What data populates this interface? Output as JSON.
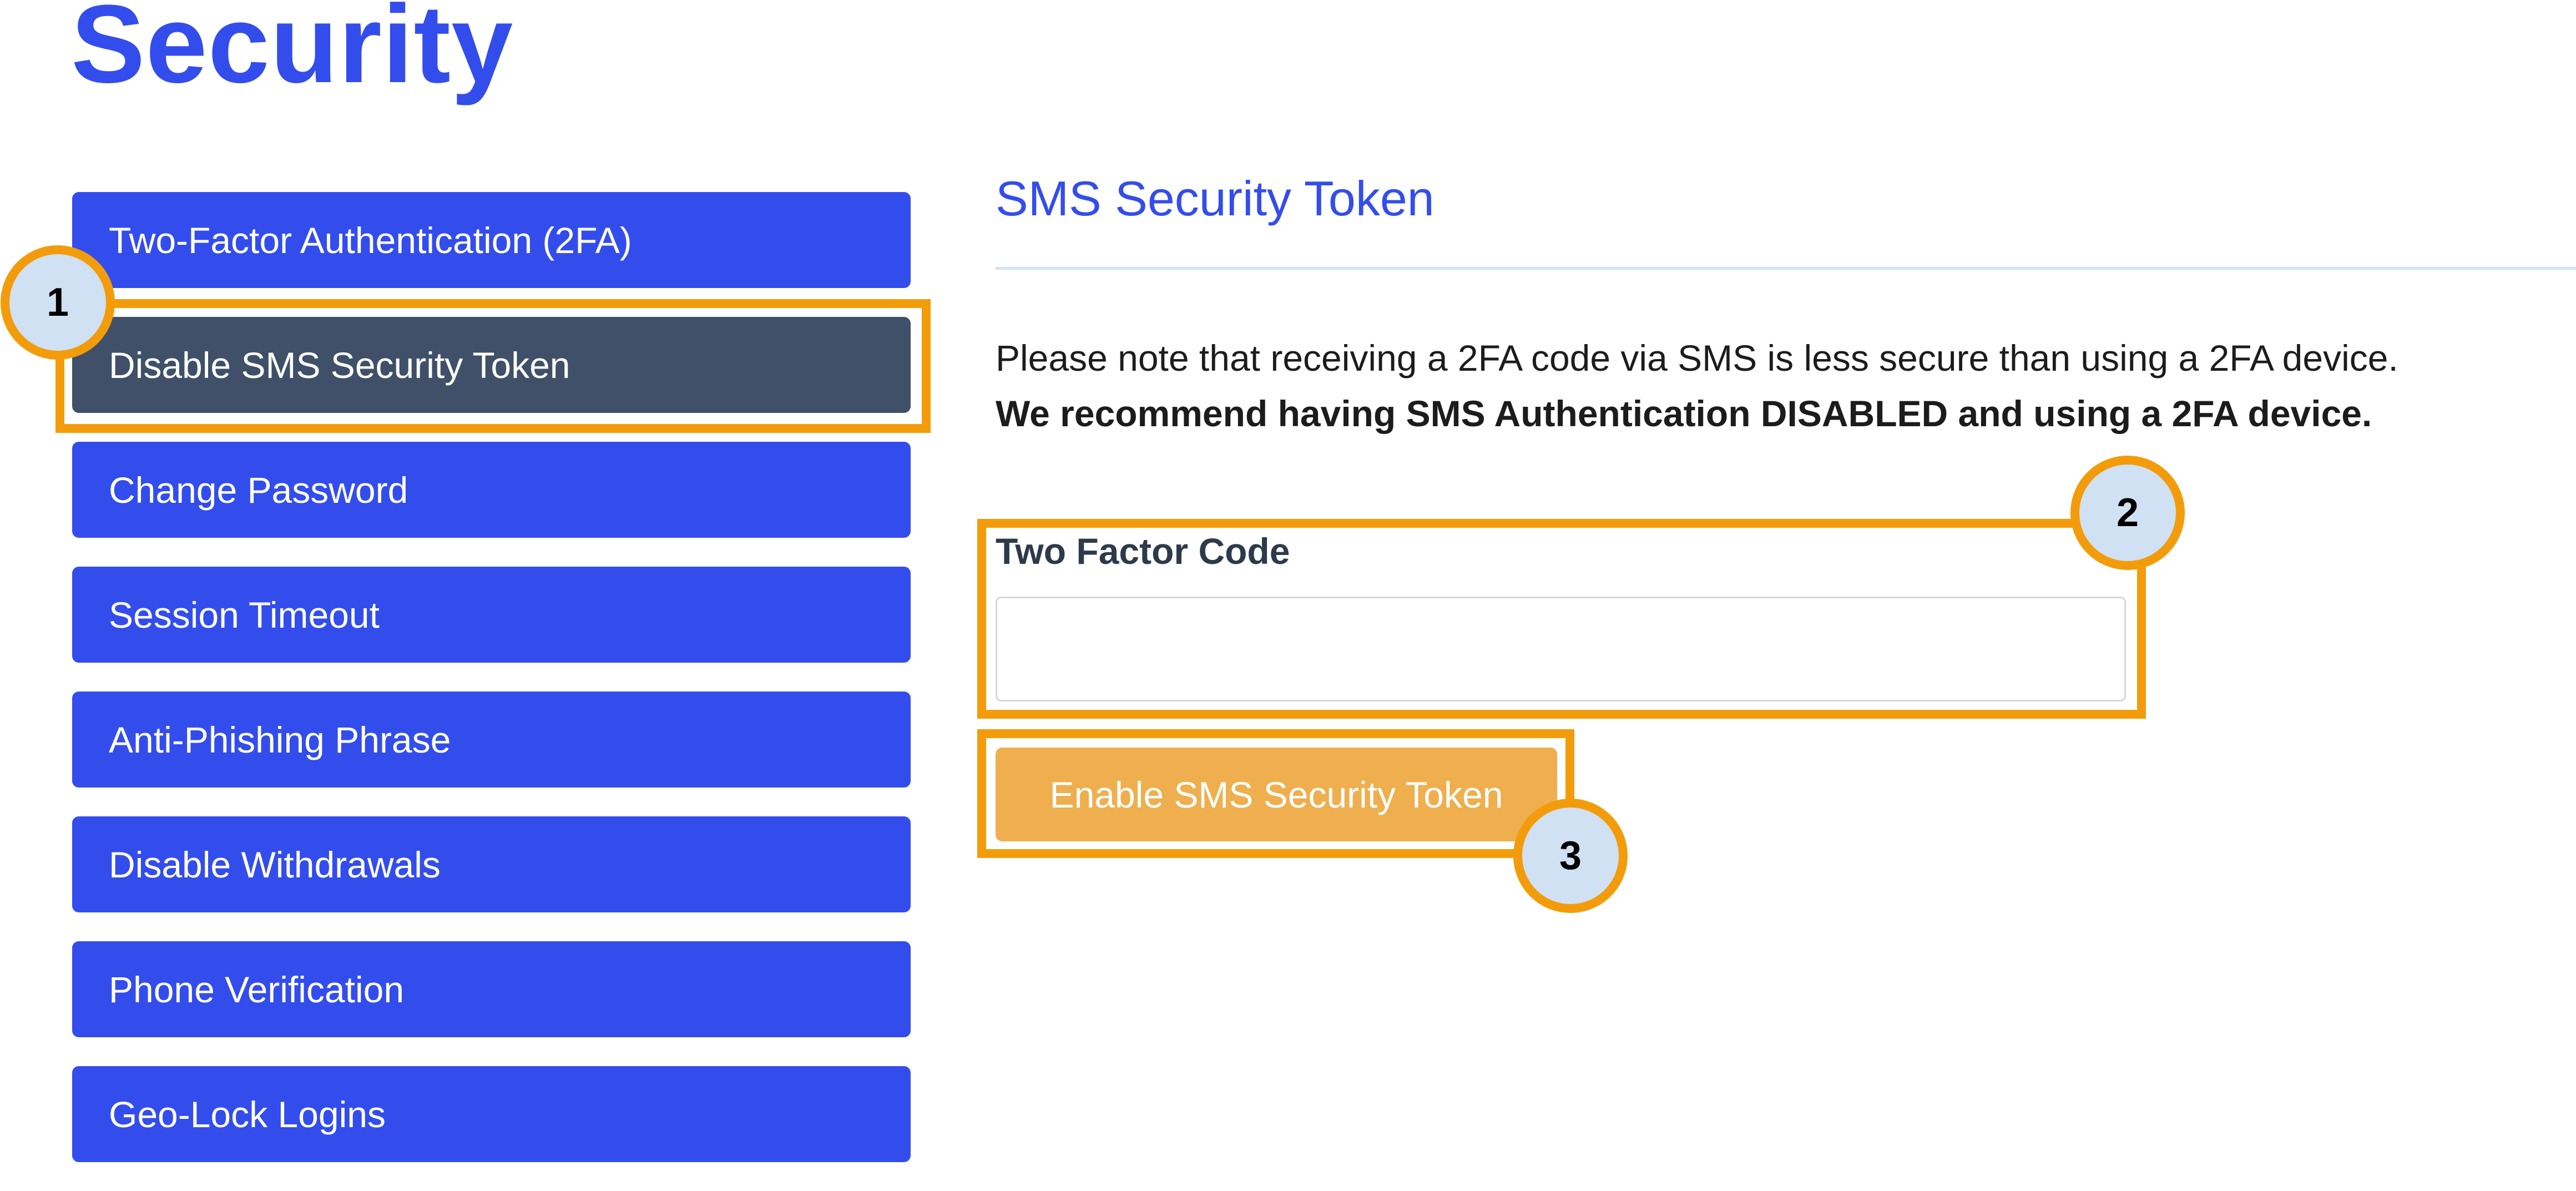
{
  "page": {
    "title": "Security"
  },
  "sidebar": {
    "active_index": 1,
    "items": [
      {
        "label": "Two-Factor Authentication (2FA)"
      },
      {
        "label": "Disable SMS Security Token"
      },
      {
        "label": "Change Password"
      },
      {
        "label": "Session Timeout"
      },
      {
        "label": "Anti-Phishing Phrase"
      },
      {
        "label": "Disable Withdrawals"
      },
      {
        "label": "Phone Verification"
      },
      {
        "label": "Geo-Lock Logins"
      }
    ]
  },
  "main": {
    "heading": "SMS Security Token",
    "note_line1": "Please note that receiving a 2FA code via SMS is less secure than using a 2FA device.",
    "note_line2": "We recommend having SMS Authentication DISABLED and using a 2FA device.",
    "field_label": "Two Factor Code",
    "field_value": "",
    "field_placeholder": "",
    "submit_label": "Enable SMS Security Token"
  },
  "annotations": [
    {
      "number": "1",
      "target": "Disable SMS Security Token menu item"
    },
    {
      "number": "2",
      "target": "Two Factor Code field"
    },
    {
      "number": "3",
      "target": "Enable SMS Security Token button"
    }
  ],
  "colors": {
    "brand_blue": "#334ded",
    "active_item": "#3f5068",
    "enable_button": "#efaf4e",
    "annotation_orange": "#f39c0b",
    "annotation_fill": "#cfe1f2"
  }
}
